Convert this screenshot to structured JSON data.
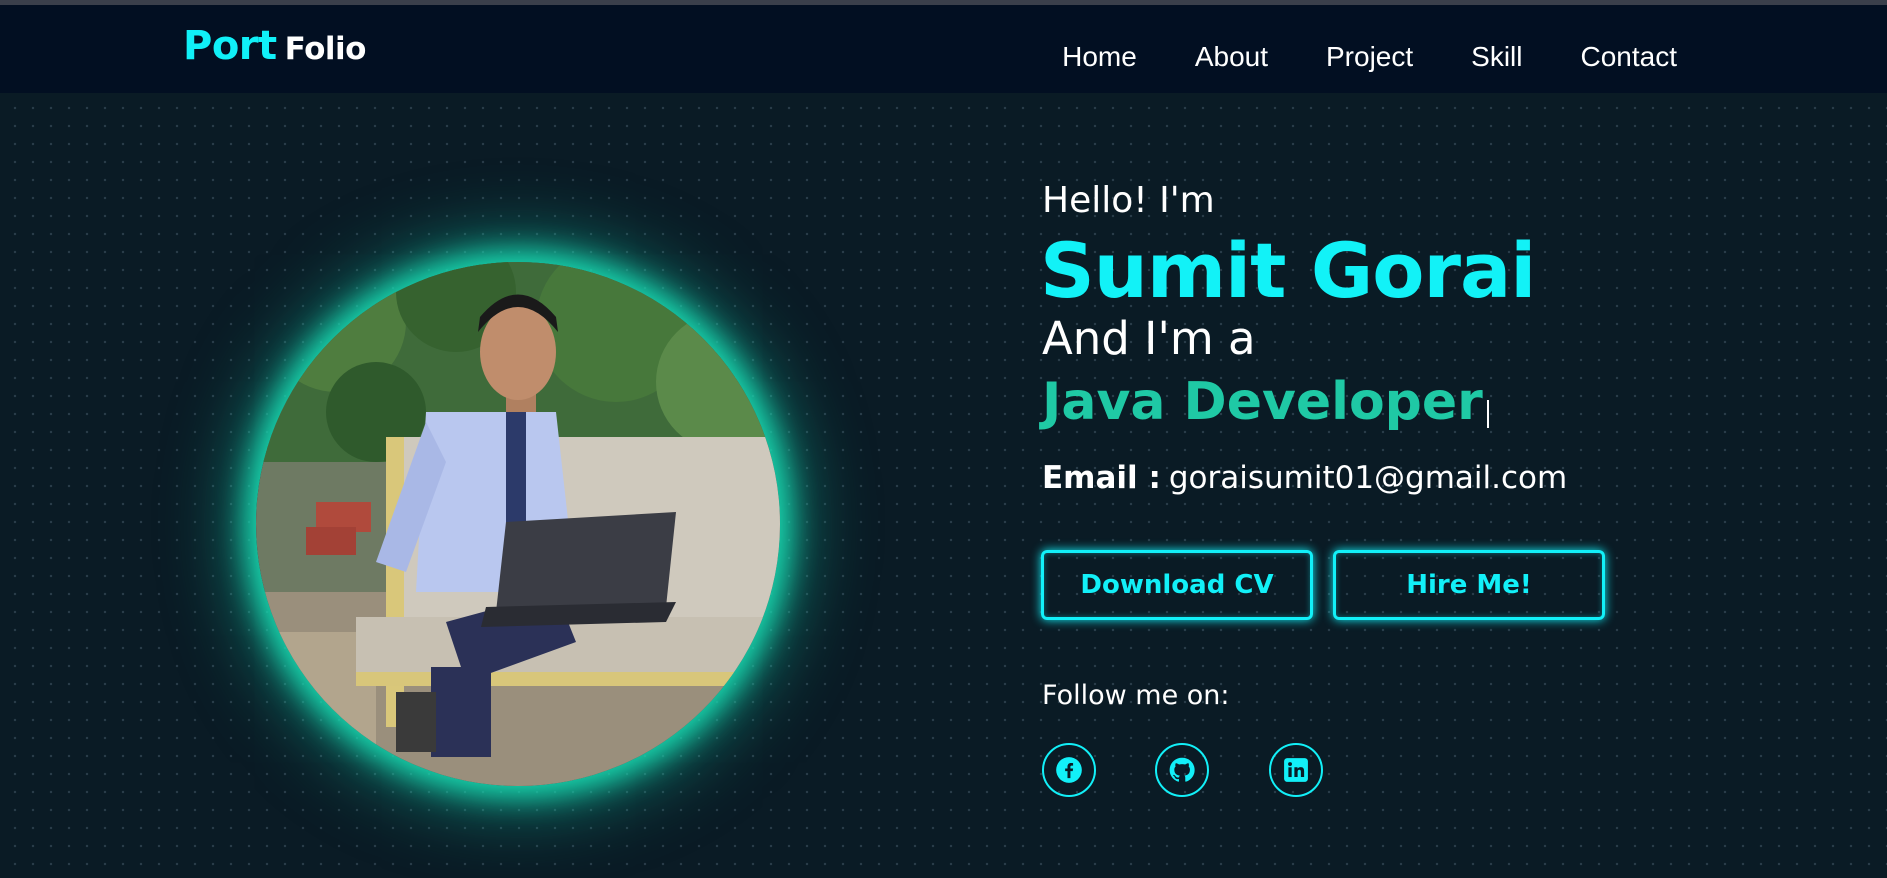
{
  "header": {
    "logo_part1": "Port",
    "logo_part2": "Folio",
    "nav": [
      "Home",
      "About",
      "Project",
      "Skill",
      "Contact"
    ]
  },
  "hero": {
    "greeting": "Hello! I'm",
    "name": "Sumit Gorai",
    "intro": "And I'm a",
    "role": "Java Developer",
    "email_label": "Email :",
    "email_value": "goraisumit01@gmail.com",
    "buttons": {
      "download": "Download CV",
      "hire": "Hire Me!"
    },
    "follow_label": "Follow me on:",
    "socials": [
      "facebook-icon",
      "github-icon",
      "linkedin-icon"
    ]
  },
  "colors": {
    "accent": "#12f2f7",
    "role": "#1fc9a5",
    "nav_bg": "#020f22",
    "page_bg": "#0a1b25"
  }
}
